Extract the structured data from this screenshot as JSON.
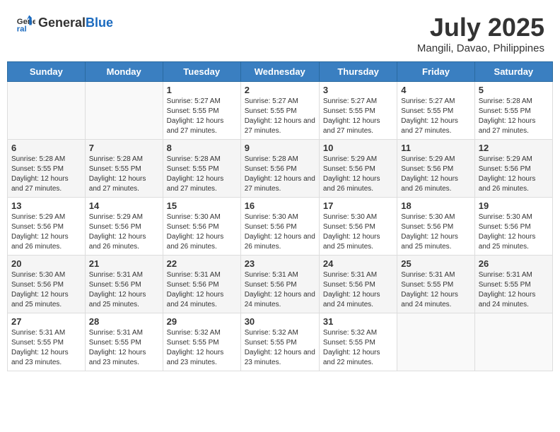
{
  "header": {
    "logo_general": "General",
    "logo_blue": "Blue",
    "month_year": "July 2025",
    "location": "Mangili, Davao, Philippines"
  },
  "days_of_week": [
    "Sunday",
    "Monday",
    "Tuesday",
    "Wednesday",
    "Thursday",
    "Friday",
    "Saturday"
  ],
  "weeks": [
    {
      "days": [
        {
          "number": "",
          "sunrise": "",
          "sunset": "",
          "daylight": ""
        },
        {
          "number": "",
          "sunrise": "",
          "sunset": "",
          "daylight": ""
        },
        {
          "number": "1",
          "sunrise": "Sunrise: 5:27 AM",
          "sunset": "Sunset: 5:55 PM",
          "daylight": "Daylight: 12 hours and 27 minutes."
        },
        {
          "number": "2",
          "sunrise": "Sunrise: 5:27 AM",
          "sunset": "Sunset: 5:55 PM",
          "daylight": "Daylight: 12 hours and 27 minutes."
        },
        {
          "number": "3",
          "sunrise": "Sunrise: 5:27 AM",
          "sunset": "Sunset: 5:55 PM",
          "daylight": "Daylight: 12 hours and 27 minutes."
        },
        {
          "number": "4",
          "sunrise": "Sunrise: 5:27 AM",
          "sunset": "Sunset: 5:55 PM",
          "daylight": "Daylight: 12 hours and 27 minutes."
        },
        {
          "number": "5",
          "sunrise": "Sunrise: 5:28 AM",
          "sunset": "Sunset: 5:55 PM",
          "daylight": "Daylight: 12 hours and 27 minutes."
        }
      ]
    },
    {
      "days": [
        {
          "number": "6",
          "sunrise": "Sunrise: 5:28 AM",
          "sunset": "Sunset: 5:55 PM",
          "daylight": "Daylight: 12 hours and 27 minutes."
        },
        {
          "number": "7",
          "sunrise": "Sunrise: 5:28 AM",
          "sunset": "Sunset: 5:55 PM",
          "daylight": "Daylight: 12 hours and 27 minutes."
        },
        {
          "number": "8",
          "sunrise": "Sunrise: 5:28 AM",
          "sunset": "Sunset: 5:55 PM",
          "daylight": "Daylight: 12 hours and 27 minutes."
        },
        {
          "number": "9",
          "sunrise": "Sunrise: 5:28 AM",
          "sunset": "Sunset: 5:56 PM",
          "daylight": "Daylight: 12 hours and 27 minutes."
        },
        {
          "number": "10",
          "sunrise": "Sunrise: 5:29 AM",
          "sunset": "Sunset: 5:56 PM",
          "daylight": "Daylight: 12 hours and 26 minutes."
        },
        {
          "number": "11",
          "sunrise": "Sunrise: 5:29 AM",
          "sunset": "Sunset: 5:56 PM",
          "daylight": "Daylight: 12 hours and 26 minutes."
        },
        {
          "number": "12",
          "sunrise": "Sunrise: 5:29 AM",
          "sunset": "Sunset: 5:56 PM",
          "daylight": "Daylight: 12 hours and 26 minutes."
        }
      ]
    },
    {
      "days": [
        {
          "number": "13",
          "sunrise": "Sunrise: 5:29 AM",
          "sunset": "Sunset: 5:56 PM",
          "daylight": "Daylight: 12 hours and 26 minutes."
        },
        {
          "number": "14",
          "sunrise": "Sunrise: 5:29 AM",
          "sunset": "Sunset: 5:56 PM",
          "daylight": "Daylight: 12 hours and 26 minutes."
        },
        {
          "number": "15",
          "sunrise": "Sunrise: 5:30 AM",
          "sunset": "Sunset: 5:56 PM",
          "daylight": "Daylight: 12 hours and 26 minutes."
        },
        {
          "number": "16",
          "sunrise": "Sunrise: 5:30 AM",
          "sunset": "Sunset: 5:56 PM",
          "daylight": "Daylight: 12 hours and 26 minutes."
        },
        {
          "number": "17",
          "sunrise": "Sunrise: 5:30 AM",
          "sunset": "Sunset: 5:56 PM",
          "daylight": "Daylight: 12 hours and 25 minutes."
        },
        {
          "number": "18",
          "sunrise": "Sunrise: 5:30 AM",
          "sunset": "Sunset: 5:56 PM",
          "daylight": "Daylight: 12 hours and 25 minutes."
        },
        {
          "number": "19",
          "sunrise": "Sunrise: 5:30 AM",
          "sunset": "Sunset: 5:56 PM",
          "daylight": "Daylight: 12 hours and 25 minutes."
        }
      ]
    },
    {
      "days": [
        {
          "number": "20",
          "sunrise": "Sunrise: 5:30 AM",
          "sunset": "Sunset: 5:56 PM",
          "daylight": "Daylight: 12 hours and 25 minutes."
        },
        {
          "number": "21",
          "sunrise": "Sunrise: 5:31 AM",
          "sunset": "Sunset: 5:56 PM",
          "daylight": "Daylight: 12 hours and 25 minutes."
        },
        {
          "number": "22",
          "sunrise": "Sunrise: 5:31 AM",
          "sunset": "Sunset: 5:56 PM",
          "daylight": "Daylight: 12 hours and 24 minutes."
        },
        {
          "number": "23",
          "sunrise": "Sunrise: 5:31 AM",
          "sunset": "Sunset: 5:56 PM",
          "daylight": "Daylight: 12 hours and 24 minutes."
        },
        {
          "number": "24",
          "sunrise": "Sunrise: 5:31 AM",
          "sunset": "Sunset: 5:56 PM",
          "daylight": "Daylight: 12 hours and 24 minutes."
        },
        {
          "number": "25",
          "sunrise": "Sunrise: 5:31 AM",
          "sunset": "Sunset: 5:55 PM",
          "daylight": "Daylight: 12 hours and 24 minutes."
        },
        {
          "number": "26",
          "sunrise": "Sunrise: 5:31 AM",
          "sunset": "Sunset: 5:55 PM",
          "daylight": "Daylight: 12 hours and 24 minutes."
        }
      ]
    },
    {
      "days": [
        {
          "number": "27",
          "sunrise": "Sunrise: 5:31 AM",
          "sunset": "Sunset: 5:55 PM",
          "daylight": "Daylight: 12 hours and 23 minutes."
        },
        {
          "number": "28",
          "sunrise": "Sunrise: 5:31 AM",
          "sunset": "Sunset: 5:55 PM",
          "daylight": "Daylight: 12 hours and 23 minutes."
        },
        {
          "number": "29",
          "sunrise": "Sunrise: 5:32 AM",
          "sunset": "Sunset: 5:55 PM",
          "daylight": "Daylight: 12 hours and 23 minutes."
        },
        {
          "number": "30",
          "sunrise": "Sunrise: 5:32 AM",
          "sunset": "Sunset: 5:55 PM",
          "daylight": "Daylight: 12 hours and 23 minutes."
        },
        {
          "number": "31",
          "sunrise": "Sunrise: 5:32 AM",
          "sunset": "Sunset: 5:55 PM",
          "daylight": "Daylight: 12 hours and 22 minutes."
        },
        {
          "number": "",
          "sunrise": "",
          "sunset": "",
          "daylight": ""
        },
        {
          "number": "",
          "sunrise": "",
          "sunset": "",
          "daylight": ""
        }
      ]
    }
  ]
}
